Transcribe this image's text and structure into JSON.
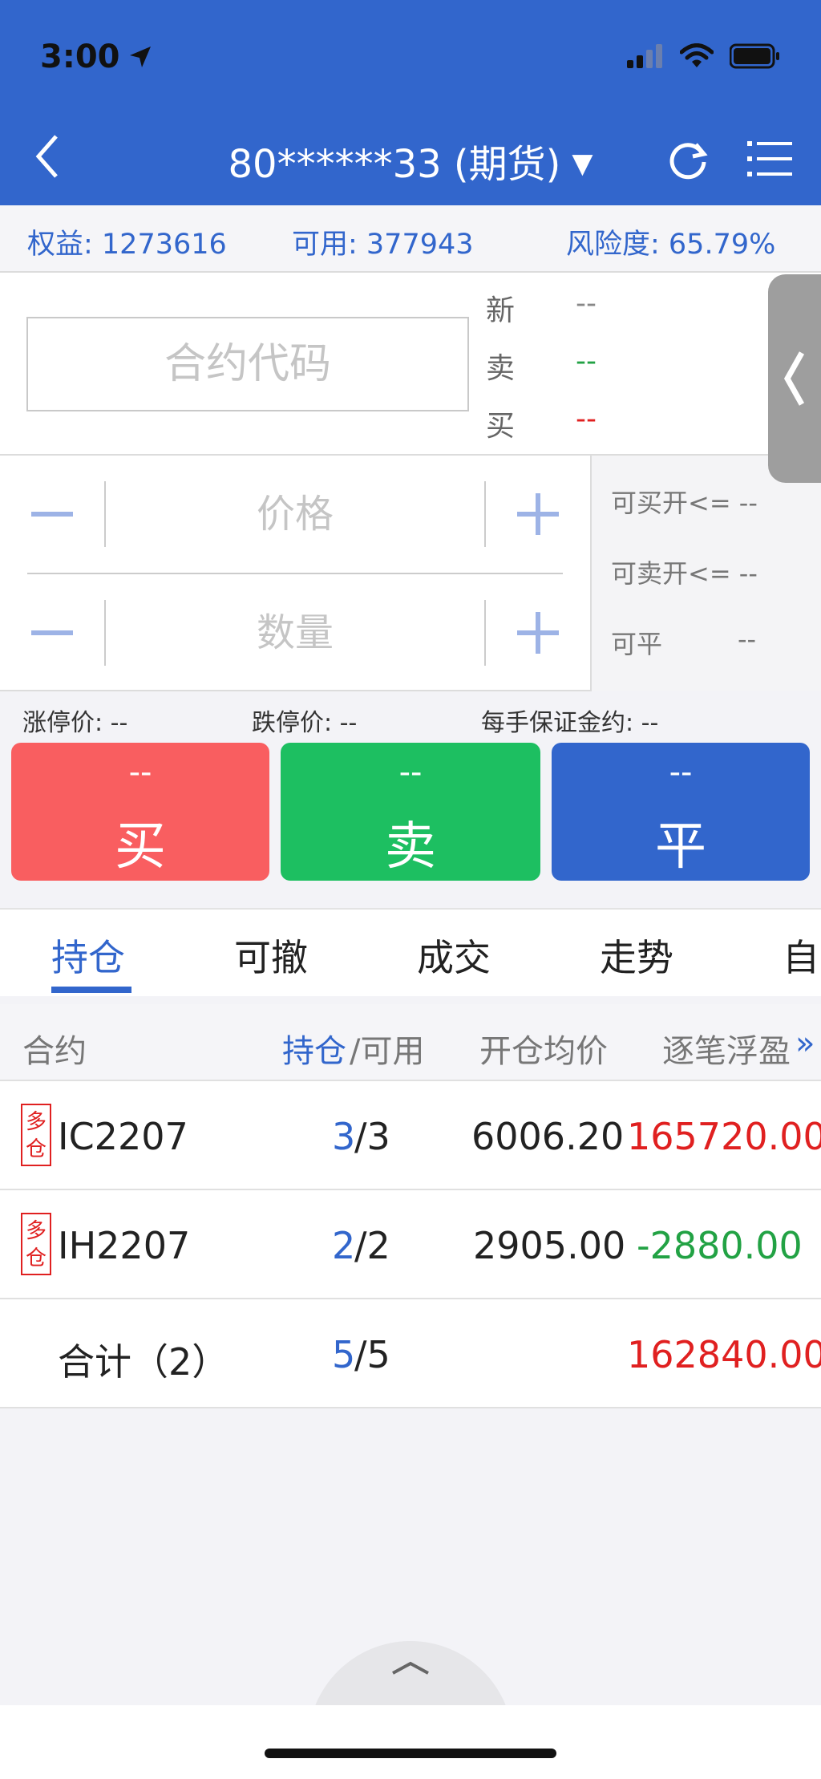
{
  "status_bar": {
    "time": "3:00"
  },
  "nav": {
    "title": "80******33 (期货)"
  },
  "account": {
    "equity": "权益: 1273616",
    "available": "可用: 377943",
    "risk": "风险度: 65.79%"
  },
  "quote": {
    "code_placeholder": "合约代码",
    "last_label": "新",
    "last_value": "--",
    "ask_label": "卖",
    "ask_value": "--",
    "bid_label": "买",
    "bid_value": "--"
  },
  "order": {
    "price_placeholder": "价格",
    "qty_placeholder": "数量",
    "can_buy_open": "可买开<= --",
    "can_sell_open": "可卖开<= --",
    "can_close_label": "可平",
    "can_close_value": "--"
  },
  "limits": {
    "limit_up": "涨停价: --",
    "limit_down": "跌停价: --",
    "margin_per_lot": "每手保证金约: --"
  },
  "actions": {
    "buy": {
      "price": "--",
      "label": "买"
    },
    "sell": {
      "price": "--",
      "label": "卖"
    },
    "close": {
      "price": "--",
      "label": "平"
    }
  },
  "tabs": [
    "持仓",
    "可撤",
    "成交",
    "走势",
    "自"
  ],
  "table": {
    "headers": {
      "contract": "合约",
      "position": "持仓",
      "slash_available": "/可用",
      "avg_open": "开仓均价",
      "floating_pnl": "逐笔浮盈"
    },
    "rows": [
      {
        "badge": "多仓",
        "contract": "IC2207",
        "position": "3",
        "available": "/3",
        "avg_price": "6006.20",
        "pnl": "165720.00"
      },
      {
        "badge": "多仓",
        "contract": "IH2207",
        "position": "2",
        "available": "/2",
        "avg_price": "2905.00",
        "pnl": "-2880.00"
      }
    ],
    "total": {
      "label": "合计（2）",
      "position": "5",
      "available": "/5",
      "pnl": "162840.00"
    }
  },
  "colors": {
    "brand": "#3266cc",
    "buy": "#f95e60",
    "sell": "#1dbf61",
    "profit": "#e02020",
    "loss": "#22a244"
  }
}
